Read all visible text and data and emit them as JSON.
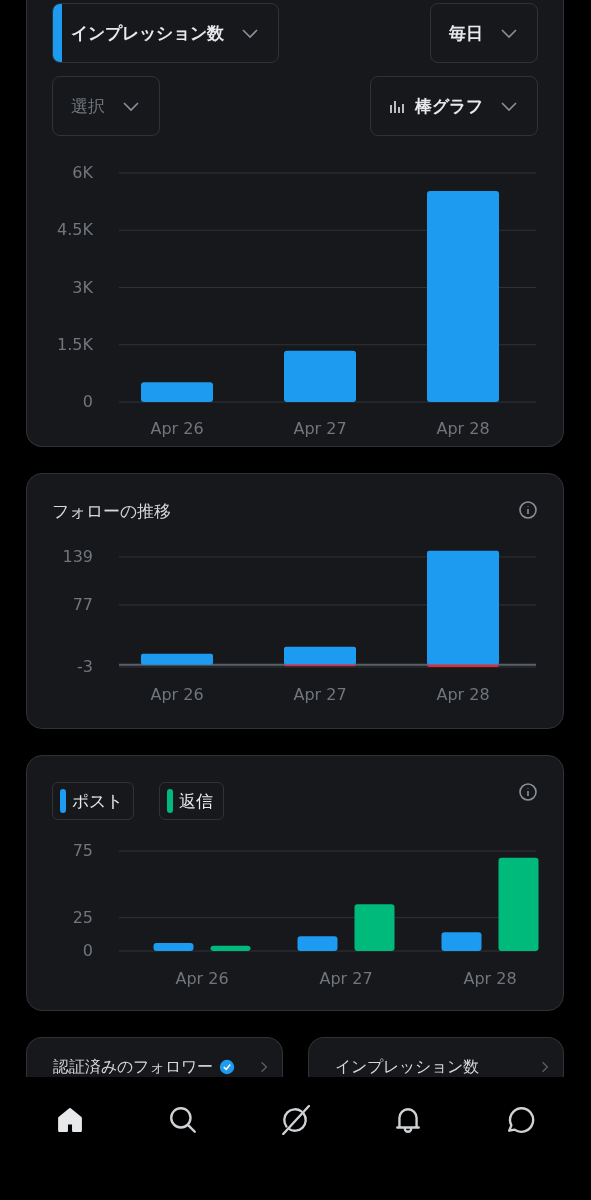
{
  "impressions_card": {
    "metric_dropdown": {
      "label": "インプレッション数",
      "color": "#1d9bf0"
    },
    "period_dropdown": {
      "label": "毎日"
    },
    "compare_dropdown": {
      "placeholder": "選択"
    },
    "chart_type_dropdown": {
      "label": "棒グラフ"
    },
    "chart_data": {
      "type": "bar",
      "categories": [
        "Apr 26",
        "Apr 27",
        "Apr 28"
      ],
      "values": [
        520,
        1340,
        5530
      ],
      "ylim": [
        0,
        6000
      ],
      "grid": true,
      "yticks": [
        {
          "value": 0,
          "label": "0"
        },
        {
          "value": 1500,
          "label": "1.5K"
        },
        {
          "value": 3000,
          "label": "3K"
        },
        {
          "value": 4500,
          "label": "4.5K"
        },
        {
          "value": 6000,
          "label": "6K"
        }
      ]
    }
  },
  "follows_card": {
    "title": "フォローの推移",
    "chart_data": {
      "type": "bar",
      "stacked": true,
      "categories": [
        "Apr 26",
        "Apr 27",
        "Apr 28"
      ],
      "series": [
        {
          "color": "#1d9bf0",
          "values": [
            14,
            23,
            147
          ]
        },
        {
          "color": "#f4212e",
          "values": [
            0,
            -2,
            -3
          ]
        }
      ],
      "yticks": [
        -3,
        77,
        139
      ],
      "ylim": [
        -3,
        148
      ],
      "grid": true
    }
  },
  "posts_card": {
    "chart_data": {
      "type": "bar",
      "categories": [
        "Apr 26",
        "Apr 27",
        "Apr 28"
      ],
      "series": [
        {
          "name": "ポスト",
          "color": "#1d9bf0",
          "values": [
            6,
            11,
            14
          ]
        },
        {
          "name": "返信",
          "color": "#00ba7c",
          "values": [
            4,
            35,
            70
          ]
        }
      ],
      "yticks": [
        0,
        25,
        75
      ],
      "ylim": [
        0,
        75
      ],
      "grid": true
    }
  },
  "summary_cards": [
    {
      "title": "認証済みのフォロワー",
      "verified": true
    },
    {
      "title": "インプレッション数",
      "verified": false
    }
  ],
  "bottom_nav": [
    {
      "kind": "home",
      "selected": true
    },
    {
      "kind": "search",
      "selected": false
    },
    {
      "kind": "grok",
      "selected": false
    },
    {
      "kind": "notifications",
      "selected": false
    },
    {
      "kind": "messages",
      "selected": false
    }
  ]
}
